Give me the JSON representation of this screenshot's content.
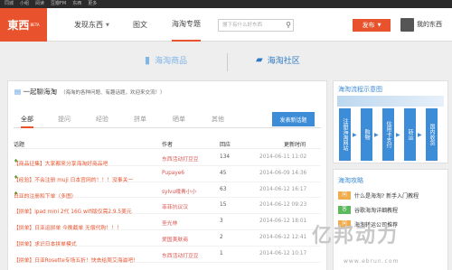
{
  "topbar": {
    "links": [
      "同城",
      "小组",
      "阅读",
      "豆瓣FM",
      "东西",
      "更多"
    ]
  },
  "header": {
    "logo": "東西",
    "logo_badge": "BETA",
    "nav": [
      {
        "label": "发现东西",
        "has_caret": true
      },
      {
        "label": "图文"
      },
      {
        "label": "海淘专题",
        "active": true
      }
    ],
    "search_placeholder": "搜下有什么好东西",
    "search_icon": "search-icon",
    "publish_label": "发布",
    "user_name": "我的东西"
  },
  "subtabs": [
    {
      "label": "海淘商品",
      "icon": "book-icon",
      "color": "#7eb6e8"
    },
    {
      "label": "海淘社区",
      "icon": "chat-icon",
      "color": "#2f79c6",
      "active": true
    }
  ],
  "panel": {
    "title": "一起聊海淘",
    "hint": "（海淘的各种问题、有趣话题，欢迎来交流！）",
    "tabs": [
      "全部",
      "提问",
      "经验",
      "拼单",
      "晒单",
      "其他"
    ],
    "new_topic": "发表新话题",
    "columns": {
      "topic": "话题",
      "author": "作者",
      "replies": "回应",
      "time": "更新时间"
    },
    "rows": [
      {
        "pin": true,
        "title": "【商品征集】大家都来分享海淘好商品吧",
        "author": "东西活动打豆豆",
        "replies": "134",
        "time": "2014-06-11 11:02"
      },
      {
        "pin": true,
        "title": "【经验】不会注册 muji 日本官网的！！！没事关一",
        "author": "Pupaye6",
        "replies": "45",
        "time": "2014-06-09 14:36"
      },
      {
        "pin": true,
        "title": "日亚的注册和下单（多图）",
        "author": "sylvu峨青小小",
        "replies": "63",
        "time": "2014-06-12 16:17"
      },
      {
        "pin": false,
        "title": "【拼单】ipad mini 2代 16G wifi版仅需2.9.5美元",
        "author": "菲菲抗议汉",
        "replies": "15",
        "time": "2014-06-12 09:23"
      },
      {
        "pin": false,
        "title": "【拼单】日亚运拼单 今晚截单 无偿代购！！！",
        "author": "圣光林",
        "replies": "3",
        "time": "2014-06-12 18:01"
      },
      {
        "pin": false,
        "title": "【拼单】求识日本拼单模式",
        "author": "爱国美肤商",
        "replies": "2",
        "time": "2014-06-12 12:41"
      },
      {
        "pin": false,
        "title": "【拼单】日亚Rosette专场五折！快去给周艾海滋吧！",
        "author": "东西活动打豆豆",
        "replies": "1",
        "time": "2014-06-12 10:17"
      }
    ]
  },
  "flow": {
    "title": "海淘流程示意图",
    "steps": [
      "注册海淘网站",
      "购物",
      "信用卡支付",
      "转运",
      "国内收货"
    ]
  },
  "faq": {
    "title": "海淘攻略",
    "items": [
      {
        "tag": "问",
        "text": "什么是海淘? 新手入门教程"
      },
      {
        "tag": "答",
        "text": "谷歌海淘详细教程"
      },
      {
        "tag": "问",
        "text": "海淘转运公司推荐"
      }
    ]
  },
  "watermark": {
    "text": "亿邦动力",
    "url": "www.ebrun.com"
  }
}
